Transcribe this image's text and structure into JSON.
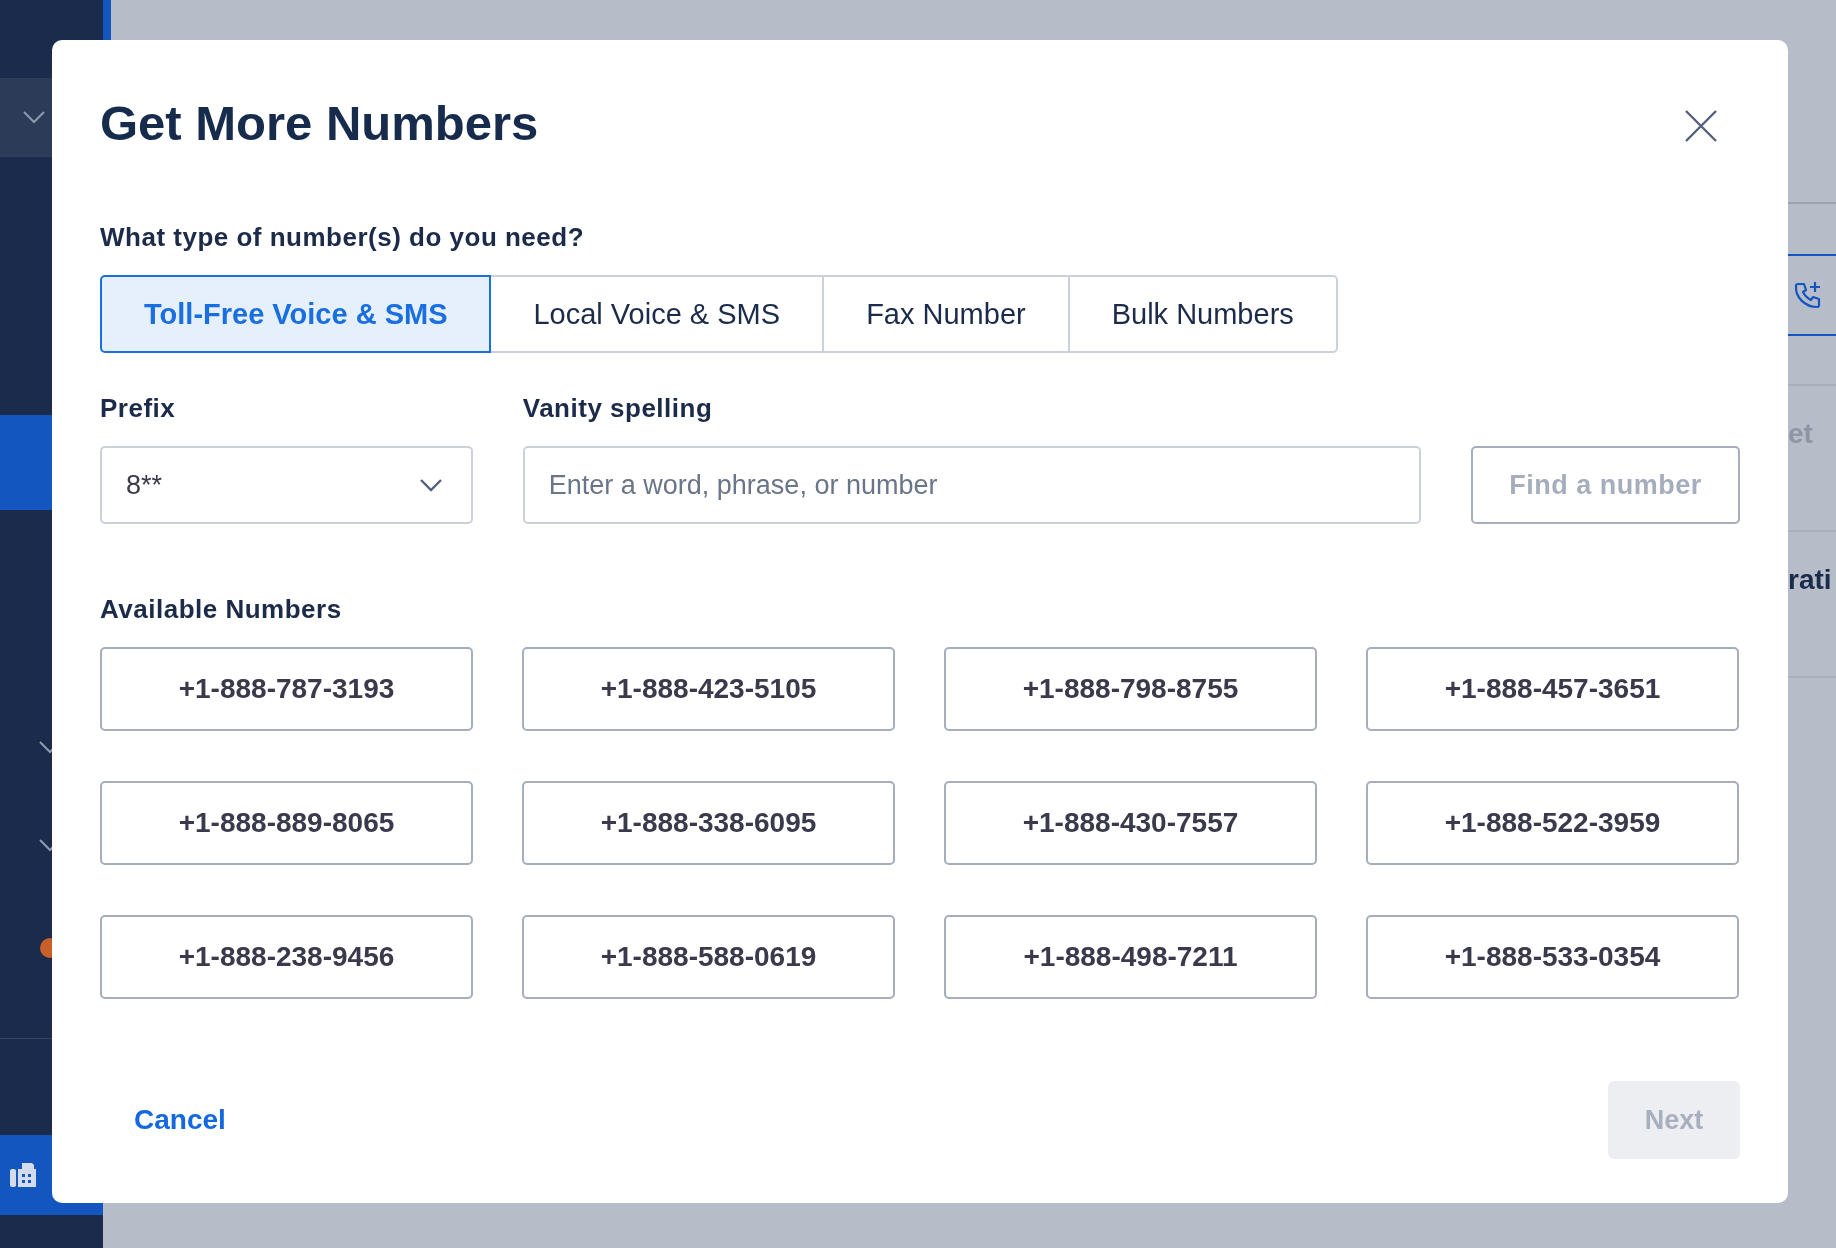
{
  "background": {
    "right_texts": [
      {
        "text": "et",
        "kind": "muted"
      },
      {
        "text": "rati",
        "kind": "strong"
      }
    ]
  },
  "dialog": {
    "title": "Get More Numbers",
    "question": "What type of number(s) do you need?",
    "tabs": [
      {
        "label": "Toll-Free Voice & SMS",
        "selected": true
      },
      {
        "label": "Local Voice & SMS",
        "selected": false
      },
      {
        "label": "Fax Number",
        "selected": false
      },
      {
        "label": "Bulk Numbers",
        "selected": false
      }
    ],
    "prefix": {
      "label": "Prefix",
      "value": "8**"
    },
    "vanity": {
      "label": "Vanity spelling",
      "placeholder": "Enter a word, phrase, or number"
    },
    "find_button": {
      "label": "Find a number",
      "disabled": true
    },
    "available_label": "Available Numbers",
    "numbers": [
      {
        "label": "+1-888-787-3193",
        "selected": false
      },
      {
        "label": "+1-888-423-5105",
        "selected": false
      },
      {
        "label": "+1-888-798-8755",
        "selected": false
      },
      {
        "label": "+1-888-457-3651",
        "selected": false
      },
      {
        "label": "+1-888-889-8065",
        "selected": false
      },
      {
        "label": "+1-888-338-6095",
        "selected": false
      },
      {
        "label": "+1-888-430-7557",
        "selected": false
      },
      {
        "label": "+1-888-522-3959",
        "selected": false
      },
      {
        "label": "+1-888-238-9456",
        "selected": false
      },
      {
        "label": "+1-888-588-0619",
        "selected": false
      },
      {
        "label": "+1-888-498-7211",
        "selected": false
      },
      {
        "label": "+1-888-533-0354",
        "selected": false
      }
    ],
    "cancel": "Cancel",
    "next_button": {
      "label": "Next",
      "disabled": true
    }
  }
}
